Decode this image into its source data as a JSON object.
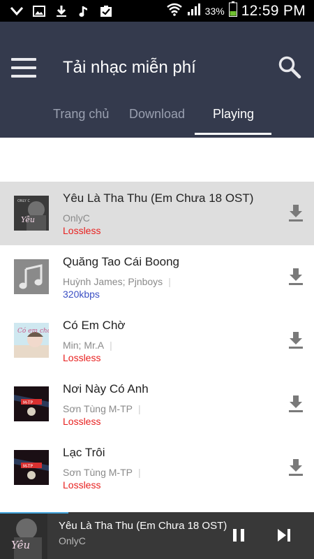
{
  "status_bar": {
    "battery_percent": "33%",
    "time": "12:59 PM"
  },
  "header": {
    "title": "Tải nhạc miễn phí",
    "tabs": [
      {
        "label": "Trang chủ",
        "active": false
      },
      {
        "label": "Download",
        "active": false
      },
      {
        "label": "Playing",
        "active": true
      }
    ]
  },
  "songs": [
    {
      "title": "Yêu Là Tha Thu (Em Chưa 18 OST)",
      "artist": "OnlyC",
      "quality": "Lossless",
      "quality_color": "#e8201f",
      "selected": true,
      "thumb_icon": "album-yeu-la-tha-thu"
    },
    {
      "title": "Quăng Tao Cái Boong",
      "artist": "Huỳnh James; Pjnboys",
      "quality": "320kbps",
      "quality_color": "#3b4fc4",
      "selected": false,
      "thumb_icon": "music-note-placeholder"
    },
    {
      "title": "Có Em Chờ",
      "artist": "Min; Mr.A",
      "quality": "Lossless",
      "quality_color": "#e8201f",
      "selected": false,
      "thumb_icon": "album-co-em-cho"
    },
    {
      "title": "Nơi Này Có Anh",
      "artist": "Sơn Tùng M-TP",
      "quality": "Lossless",
      "quality_color": "#e8201f",
      "selected": false,
      "thumb_icon": "album-son-tung"
    },
    {
      "title": "Lạc Trôi",
      "artist": "Sơn Tùng M-TP",
      "quality": "Lossless",
      "quality_color": "#e8201f",
      "selected": false,
      "thumb_icon": "album-son-tung"
    }
  ],
  "player": {
    "title": "Yêu Là Tha Thu (Em Chưa 18 OST)",
    "artist": "OnlyC",
    "thumb_icon": "album-yeu-la-tha-thu"
  },
  "colors": {
    "header_bg": "#343a4d",
    "selected_row": "#dedede",
    "lossless": "#e8201f",
    "kbps": "#3b4fc4",
    "player_bg": "#383838"
  },
  "separator": "|"
}
